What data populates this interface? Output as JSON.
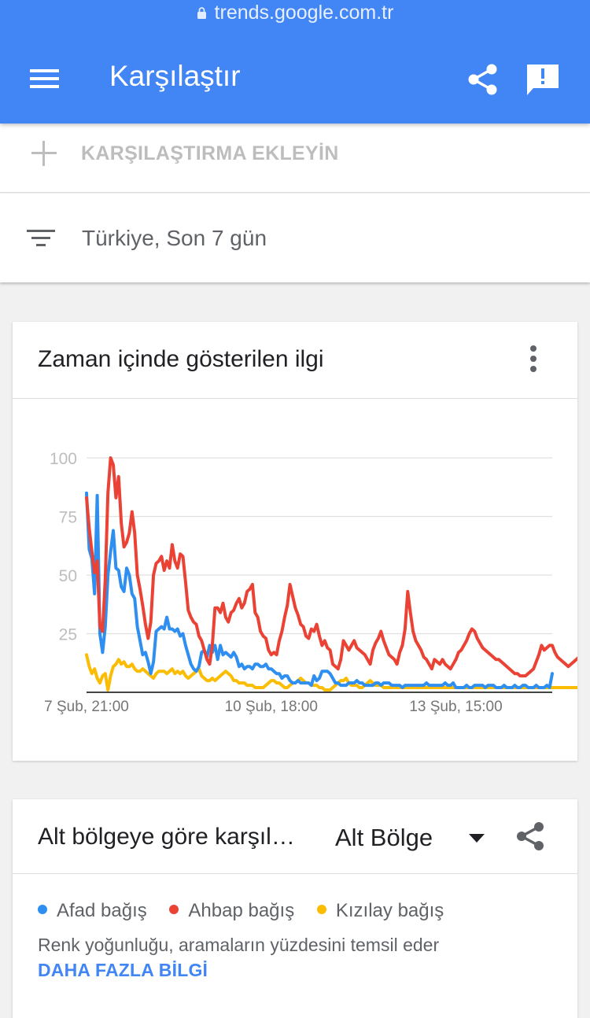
{
  "browser": {
    "url": "trends.google.com.tr"
  },
  "appbar": {
    "title": "Karşılaştır"
  },
  "compare": {
    "add_label": "KARŞILAŞTIRMA EKLEYİN"
  },
  "filter": {
    "label": "Türkiye, Son 7 gün"
  },
  "interest_card": {
    "title": "Zaman içinde gösterilen ilgi"
  },
  "region_card": {
    "title": "Alt bölgeye göre karşıl…",
    "select_value": "Alt Bölge",
    "legend": [
      {
        "label": "Afad bağış",
        "color": "#2f8ff0"
      },
      {
        "label": "Ahbap bağış",
        "color": "#ea4335"
      },
      {
        "label": "Kızılay bağış",
        "color": "#fbbc04"
      }
    ],
    "note": "Renk yoğunluğu, aramaların yüzdesini temsil eder",
    "more_link": "DAHA FAZLA BİLGİ"
  },
  "colors": {
    "appbar": "#4285f4",
    "link": "#4285f4"
  },
  "chart_data": {
    "type": "line",
    "ylim": [
      0,
      100
    ],
    "yticks": [
      25,
      50,
      75,
      100
    ],
    "x_tick_labels": [
      {
        "label": "7 Şub, 21:00",
        "index": 0
      },
      {
        "label": "10 Şub, 18:00",
        "index": 69
      },
      {
        "label": "13 Şub, 15:00",
        "index": 138
      }
    ],
    "grid": true,
    "series": [
      {
        "name": "Afad bağış",
        "color": "#2f8ff0",
        "values": [
          85,
          61,
          57,
          42,
          84,
          25,
          17,
          28,
          50,
          60,
          69,
          53,
          52,
          45,
          43,
          53,
          50,
          42,
          40,
          28,
          22,
          16,
          17,
          13,
          8,
          13,
          26,
          27,
          28,
          27,
          32,
          27,
          27,
          26,
          27,
          24,
          25,
          20,
          16,
          12,
          10,
          9,
          11,
          17,
          18,
          15,
          20,
          17,
          20,
          14,
          20,
          16,
          17,
          16,
          15,
          17,
          15,
          11,
          12,
          10,
          11,
          11,
          10,
          12,
          12,
          11,
          11,
          12,
          10,
          10,
          9,
          8,
          8,
          6,
          7,
          7,
          5,
          4,
          4,
          5,
          4,
          4,
          4,
          4,
          3,
          7,
          5,
          6,
          9,
          9,
          9,
          8,
          6,
          4,
          4,
          3,
          3,
          3,
          4,
          4,
          4,
          5,
          4,
          4,
          3,
          3,
          3,
          3,
          4,
          4,
          3,
          4,
          4,
          4,
          3,
          3,
          3,
          3,
          2,
          3,
          3,
          3,
          3,
          3,
          3,
          3,
          3,
          4,
          3,
          3,
          3,
          3,
          3,
          3,
          4,
          3,
          3,
          4,
          2,
          2,
          2,
          2,
          3,
          2,
          2,
          3,
          3,
          3,
          3,
          2,
          3,
          3,
          3,
          2,
          2,
          2,
          3,
          2,
          2,
          2,
          3,
          2,
          2,
          3,
          3,
          2,
          2,
          2,
          3,
          2,
          2,
          2,
          3,
          2,
          8
        ]
      },
      {
        "name": "Ahbap bağış",
        "color": "#ea4335",
        "values": [
          83,
          70,
          60,
          51,
          56,
          28,
          26,
          48,
          85,
          100,
          97,
          83,
          92,
          72,
          62,
          64,
          68,
          77,
          68,
          50,
          44,
          37,
          29,
          23,
          30,
          50,
          55,
          56,
          58,
          52,
          56,
          53,
          63,
          56,
          53,
          59,
          58,
          47,
          35,
          32,
          30,
          29,
          24,
          22,
          18,
          14,
          12,
          20,
          36,
          36,
          34,
          38,
          32,
          30,
          34,
          35,
          38,
          40,
          36,
          38,
          43,
          44,
          46,
          34,
          32,
          26,
          24,
          23,
          18,
          16,
          17,
          16,
          22,
          26,
          32,
          37,
          46,
          41,
          36,
          33,
          29,
          28,
          24,
          23,
          27,
          26,
          29,
          24,
          20,
          22,
          19,
          18,
          12,
          11,
          10,
          14,
          22,
          20,
          18,
          20,
          22,
          19,
          18,
          17,
          16,
          14,
          12,
          18,
          21,
          23,
          26,
          22,
          19,
          16,
          15,
          14,
          12,
          17,
          20,
          27,
          43,
          34,
          26,
          22,
          20,
          18,
          15,
          14,
          12,
          10,
          14,
          13,
          12,
          14,
          12,
          11,
          10,
          12,
          14,
          17,
          18,
          20,
          22,
          25,
          27,
          26,
          23,
          21,
          19,
          18,
          17,
          16,
          15,
          14,
          14,
          13,
          12,
          11,
          10,
          9,
          8,
          8,
          7,
          7,
          7,
          8,
          9,
          10,
          13,
          16,
          20,
          18,
          19,
          20,
          20,
          17,
          15,
          14,
          13,
          12,
          11,
          12,
          13,
          14,
          15,
          16,
          17,
          18,
          19,
          18,
          17,
          16,
          14,
          13,
          20
        ]
      },
      {
        "name": "Kızılay bağış",
        "color": "#fbbc04",
        "values": [
          16,
          11,
          8,
          10,
          6,
          4,
          7,
          8,
          1,
          7,
          11,
          12,
          14,
          12,
          13,
          11,
          11,
          12,
          10,
          9,
          9,
          10,
          9,
          8,
          7,
          6,
          8,
          9,
          9,
          9,
          8,
          9,
          10,
          8,
          9,
          8,
          9,
          7,
          6,
          7,
          8,
          9,
          10,
          7,
          6,
          5,
          5,
          6,
          5,
          6,
          7,
          8,
          9,
          8,
          7,
          5,
          5,
          4,
          4,
          4,
          3,
          3,
          3,
          2,
          2,
          2,
          2,
          3,
          4,
          5,
          5,
          4,
          4,
          3,
          2,
          2,
          3,
          4,
          4,
          5,
          6,
          5,
          4,
          4,
          3,
          3,
          3,
          2,
          2,
          1,
          1,
          1,
          2,
          3,
          4,
          5,
          5,
          6,
          4,
          3,
          3,
          3,
          2,
          2,
          3,
          4,
          5,
          4,
          3,
          3,
          3,
          2,
          2,
          2,
          2,
          2,
          2,
          2,
          2,
          2,
          2,
          2,
          2,
          2,
          2,
          2,
          2,
          2,
          2,
          2,
          2,
          2,
          2,
          2,
          2,
          2,
          2,
          2,
          2,
          2,
          2,
          2,
          2,
          2,
          2,
          2,
          2,
          2,
          2,
          2,
          2,
          2,
          2,
          2,
          2,
          2,
          2,
          2,
          2,
          2,
          2,
          2,
          2,
          2,
          2,
          2,
          2,
          2,
          2,
          2,
          2,
          2,
          2,
          2,
          2,
          2,
          2,
          2,
          2,
          2,
          2,
          2,
          2,
          2,
          2,
          2,
          2,
          2,
          2,
          2,
          2,
          2,
          2,
          2,
          3
        ]
      }
    ]
  }
}
